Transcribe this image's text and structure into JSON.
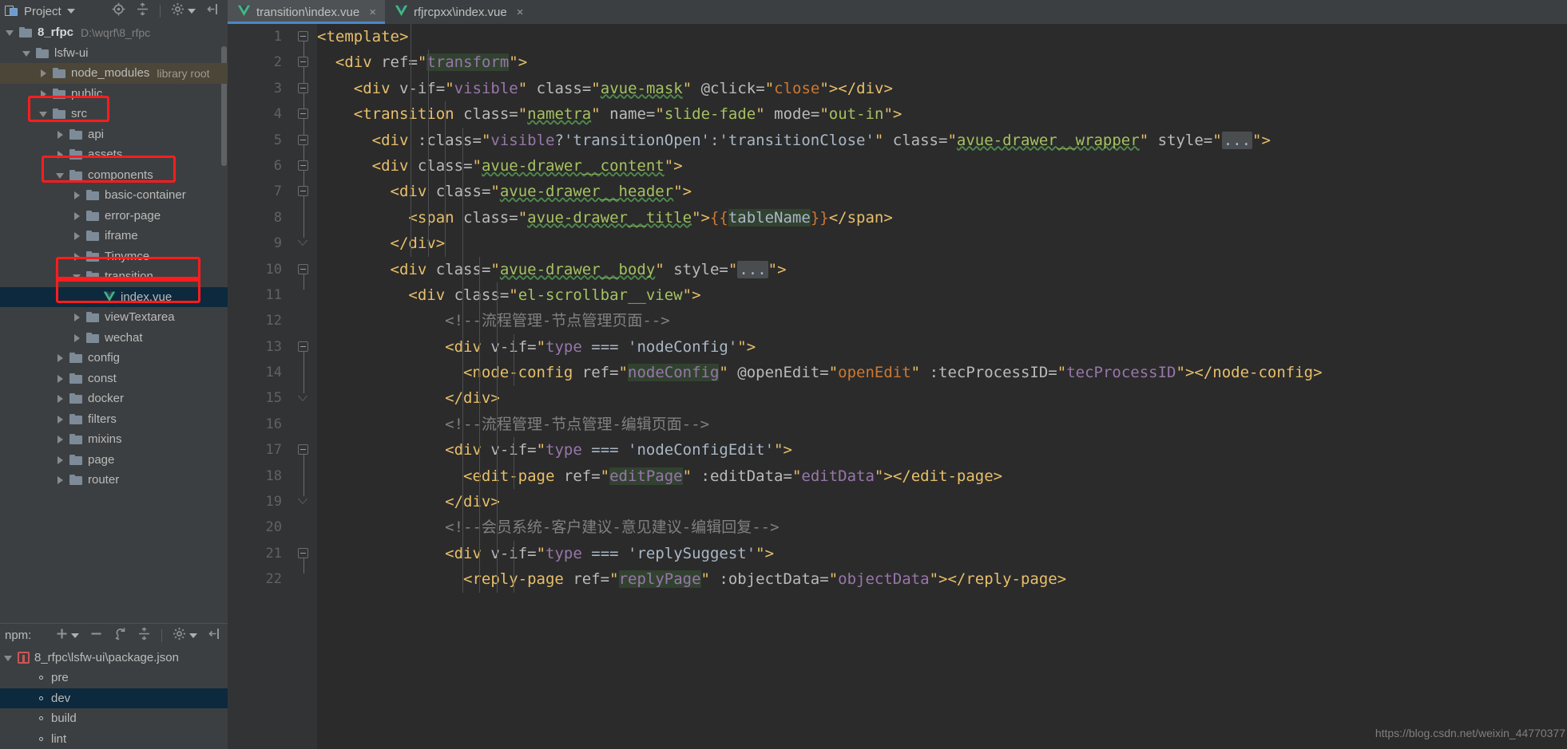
{
  "project_panel": {
    "title": "Project",
    "icons": [
      "project-icon",
      "chevron-down-icon",
      "locate-icon",
      "collapse-all-icon",
      "gear-icon",
      "hide-icon"
    ],
    "tree": [
      {
        "label": "8_rfpc",
        "suffix": "D:\\wqrf\\8_rfpc",
        "kind": "root",
        "arrow": "down",
        "indent": 0,
        "bold": true
      },
      {
        "label": "lsfw-ui",
        "suffix": "",
        "kind": "folder",
        "arrow": "down",
        "indent": 1
      },
      {
        "label": "node_modules",
        "suffix": "library root",
        "kind": "folder",
        "arrow": "right",
        "indent": 2,
        "state": "library"
      },
      {
        "label": "public",
        "suffix": "",
        "kind": "folder",
        "arrow": "right",
        "indent": 2
      },
      {
        "label": "src",
        "suffix": "",
        "kind": "folder",
        "arrow": "down",
        "indent": 2,
        "annotated": true
      },
      {
        "label": "api",
        "suffix": "",
        "kind": "folder",
        "arrow": "right",
        "indent": 3
      },
      {
        "label": "assets",
        "suffix": "",
        "kind": "folder",
        "arrow": "right",
        "indent": 3
      },
      {
        "label": "components",
        "suffix": "",
        "kind": "folder",
        "arrow": "down",
        "indent": 3,
        "annotated": true
      },
      {
        "label": "basic-container",
        "suffix": "",
        "kind": "folder",
        "arrow": "right",
        "indent": 4
      },
      {
        "label": "error-page",
        "suffix": "",
        "kind": "folder",
        "arrow": "right",
        "indent": 4
      },
      {
        "label": "iframe",
        "suffix": "",
        "kind": "folder",
        "arrow": "right",
        "indent": 4
      },
      {
        "label": "Tinymce",
        "suffix": "",
        "kind": "folder",
        "arrow": "right",
        "indent": 4
      },
      {
        "label": "transition",
        "suffix": "",
        "kind": "folder",
        "arrow": "down",
        "indent": 4,
        "annotated": true
      },
      {
        "label": "index.vue",
        "suffix": "",
        "kind": "vue",
        "arrow": "none",
        "indent": 5,
        "state": "selected",
        "annotated": true
      },
      {
        "label": "viewTextarea",
        "suffix": "",
        "kind": "folder",
        "arrow": "right",
        "indent": 4
      },
      {
        "label": "wechat",
        "suffix": "",
        "kind": "folder",
        "arrow": "right",
        "indent": 4
      },
      {
        "label": "config",
        "suffix": "",
        "kind": "folder",
        "arrow": "right",
        "indent": 3
      },
      {
        "label": "const",
        "suffix": "",
        "kind": "folder",
        "arrow": "right",
        "indent": 3
      },
      {
        "label": "docker",
        "suffix": "",
        "kind": "folder",
        "arrow": "right",
        "indent": 3
      },
      {
        "label": "filters",
        "suffix": "",
        "kind": "folder",
        "arrow": "right",
        "indent": 3
      },
      {
        "label": "mixins",
        "suffix": "",
        "kind": "folder",
        "arrow": "right",
        "indent": 3
      },
      {
        "label": "page",
        "suffix": "",
        "kind": "folder",
        "arrow": "right",
        "indent": 3
      },
      {
        "label": "router",
        "suffix": "",
        "kind": "folder",
        "arrow": "right",
        "indent": 3
      }
    ]
  },
  "npm_panel": {
    "label": "npm:",
    "icons": [
      "add-icon",
      "chevron-down-icon",
      "remove-icon",
      "refresh-icon",
      "collapse-all-icon",
      "gear-icon",
      "hide-icon"
    ],
    "items": [
      {
        "label": "8_rfpc\\lsfw-ui\\package.json",
        "kind": "json",
        "arrow": "down",
        "indent": 0
      },
      {
        "label": "pre",
        "kind": "script",
        "arrow": "none",
        "indent": 1
      },
      {
        "label": "dev",
        "kind": "script",
        "arrow": "none",
        "indent": 1,
        "state": "selected"
      },
      {
        "label": "build",
        "kind": "script",
        "arrow": "none",
        "indent": 1
      },
      {
        "label": "lint",
        "kind": "script",
        "arrow": "none",
        "indent": 1
      }
    ]
  },
  "editor": {
    "tabs": [
      {
        "label": "transition\\index.vue",
        "icon": "vue-icon",
        "active": true,
        "close": "×"
      },
      {
        "label": "rfjrcpxx\\index.vue",
        "icon": "vue-icon",
        "active": false,
        "close": "×"
      }
    ],
    "line_numbers": [
      "1",
      "2",
      "3",
      "4",
      "5",
      "6",
      "7",
      "8",
      "9",
      "10",
      "11",
      "12",
      "13",
      "14",
      "15",
      "16",
      "17",
      "18",
      "19",
      "20",
      "21",
      "22"
    ],
    "lines": [
      {
        "n": 1,
        "indent": 0,
        "text": "<template>"
      },
      {
        "n": 2,
        "indent": 1,
        "text": "<div ref=\"transform\">"
      },
      {
        "n": 3,
        "indent": 2,
        "text": "<div v-if=\"visible\" class=\"avue-mask\" @click=\"close\"></div>"
      },
      {
        "n": 4,
        "indent": 2,
        "text": "<transition class=\"nametra\" name=\"slide-fade\" mode=\"out-in\">"
      },
      {
        "n": 5,
        "indent": 3,
        "text": "<div :class=\"visible?'transitionOpen':'transitionClose'\" class=\"avue-drawer__wrapper\" style=\"...\">"
      },
      {
        "n": 6,
        "indent": 3,
        "text": "<div class=\"avue-drawer__content\">"
      },
      {
        "n": 7,
        "indent": 4,
        "text": "<div class=\"avue-drawer__header\">"
      },
      {
        "n": 8,
        "indent": 5,
        "text": "<span class=\"avue-drawer__title\">{{tableName}}</span>"
      },
      {
        "n": 9,
        "indent": 4,
        "text": "</div>"
      },
      {
        "n": 10,
        "indent": 4,
        "text": "<div class=\"avue-drawer__body\" style=\"...\">"
      },
      {
        "n": 11,
        "indent": 5,
        "text": "<div class=\"el-scrollbar__view\">"
      },
      {
        "n": 12,
        "indent": 7,
        "text": "<!--流程管理-节点管理页面-->"
      },
      {
        "n": 13,
        "indent": 7,
        "text": "<div v-if=\"type === 'nodeConfig'\">"
      },
      {
        "n": 14,
        "indent": 8,
        "text": "<node-config ref=\"nodeConfig\" @openEdit=\"openEdit\" :tecProcessID=\"tecProcessID\"></node-config>"
      },
      {
        "n": 15,
        "indent": 7,
        "text": "</div>"
      },
      {
        "n": 16,
        "indent": 7,
        "text": "<!--流程管理-节点管理-编辑页面-->"
      },
      {
        "n": 17,
        "indent": 7,
        "text": "<div v-if=\"type === 'nodeConfigEdit'\">"
      },
      {
        "n": 18,
        "indent": 8,
        "text": "<edit-page ref=\"editPage\" :editData=\"editData\"></edit-page>"
      },
      {
        "n": 19,
        "indent": 7,
        "text": "</div>"
      },
      {
        "n": 20,
        "indent": 7,
        "text": "<!--会员系统-客户建议-意见建议-编辑回复-->"
      },
      {
        "n": 21,
        "indent": 7,
        "text": "<div v-if=\"type === 'replySuggest'\">"
      },
      {
        "n": 22,
        "indent": 8,
        "text": "<reply-page ref=\"replyPage\" :objectData=\"objectData\"></reply-page>"
      }
    ]
  },
  "watermark": "https://blog.csdn.net/weixin_44770377",
  "colors": {
    "panel_bg": "#3c3f41",
    "editor_bg": "#2b2b2b",
    "gutter_bg": "#313335",
    "selection": "#0d293e",
    "library_row": "#4b4638",
    "tab_active": "#4e5254",
    "tab_underline": "#4a88c7",
    "annotation": "#fc1d1d",
    "tag": "#e8bf6a",
    "string": "#a5c261",
    "violet": "#9876aa",
    "orange": "#cc7832",
    "comment": "#808080",
    "plain": "#a9b7c6"
  }
}
